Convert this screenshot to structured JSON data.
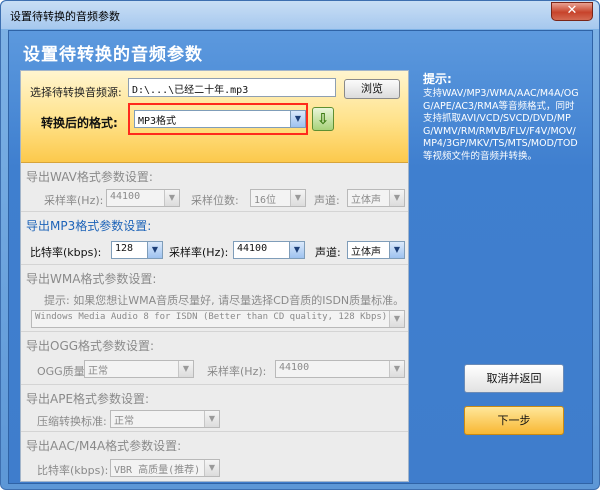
{
  "window": {
    "title": "设置待转换的音频参数",
    "close_glyph": "✕"
  },
  "header": {
    "title": "设置待转换的音频参数"
  },
  "source": {
    "label": "选择待转换音频源:",
    "path": "D:\\...\\已经二十年.mp3",
    "browse_label": "浏览"
  },
  "format": {
    "label": "转换后的格式:",
    "selected": "MP3格式",
    "arrow_glyph": "⇩",
    "highlight_color": "#ff2a1c"
  },
  "wav": {
    "title": "导出WAV格式参数设置:",
    "sample_rate_label": "采样率(Hz):",
    "sample_rate": "44100",
    "bits_label": "采样位数:",
    "bits": "16位",
    "channel_label": "声道:",
    "channel": "立体声"
  },
  "mp3": {
    "title": "导出MP3格式参数设置:",
    "bitrate_label": "比特率(kbps):",
    "bitrate": "128",
    "sample_rate_label": "采样率(Hz):",
    "sample_rate": "44100",
    "channel_label": "声道:",
    "channel": "立体声"
  },
  "wma": {
    "title": "导出WMA格式参数设置:",
    "hint": "提示: 如果您想让WMA音质尽量好, 请尽量选择CD音质的ISDN质量标准。",
    "profile": "Windows Media Audio 8 for ISDN (Better than CD quality, 128 Kbps)"
  },
  "ogg": {
    "title": "导出OGG格式参数设置:",
    "quality_label": "OGG质量:",
    "quality": "正常",
    "sample_rate_label": "采样率(Hz):",
    "sample_rate": "44100"
  },
  "ape": {
    "title": "导出APE格式参数设置:",
    "compress_label": "压缩转换标准:",
    "compress": "正常"
  },
  "aac": {
    "title": "导出AAC/M4A格式参数设置:",
    "bitrate_label": "比特率(kbps):",
    "bitrate": "VBR 高质量(推荐)"
  },
  "tips": {
    "title": "提示:",
    "text": "支持WAV/MP3/WMA/AAC/M4A/OGG/APE/AC3/RMA等音频格式，同时支持抓取AVI/VCD/SVCD/DVD/MPG/WMV/RM/RMVB/FLV/F4V/MOV/MP4/3GP/MKV/TS/MTS/MOD/TOD等视频文件的音频并转换。"
  },
  "buttons": {
    "cancel_label": "取消并返回",
    "next_label": "下一步"
  },
  "dropdown_glyph": "▼"
}
